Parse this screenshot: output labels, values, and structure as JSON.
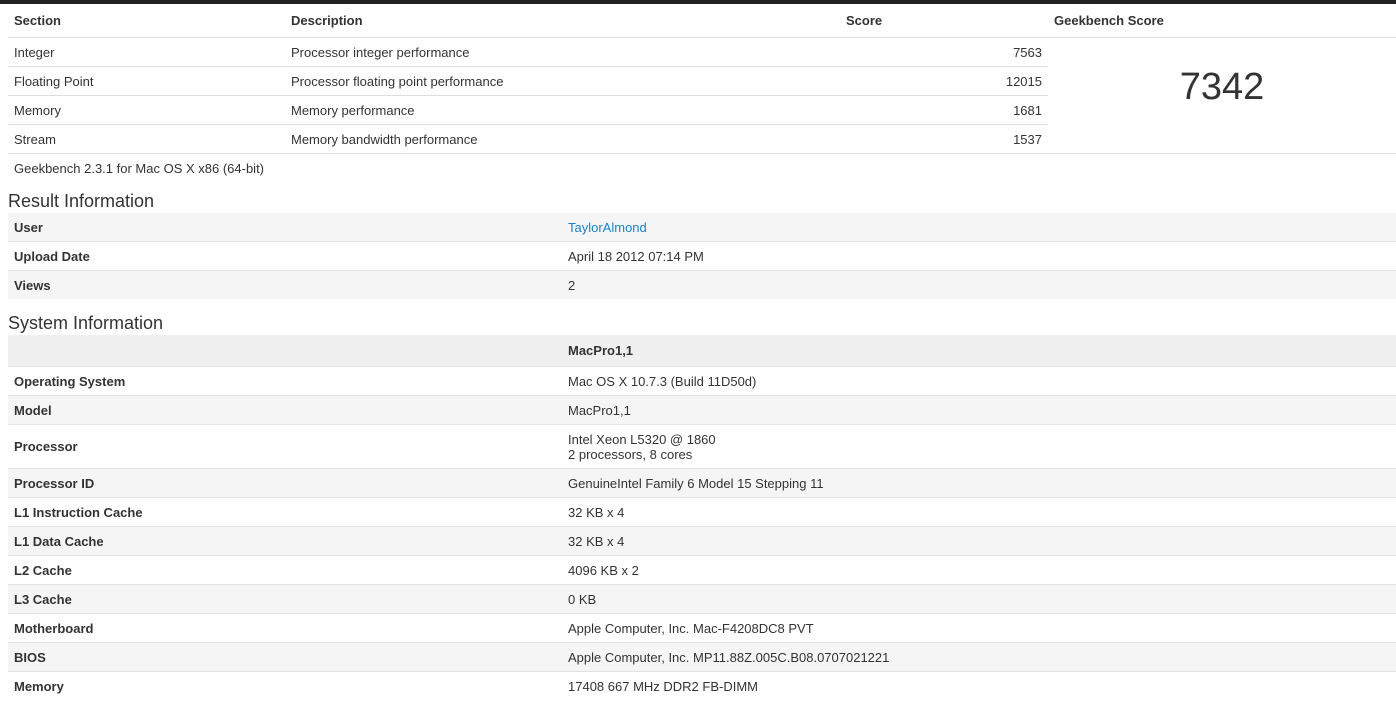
{
  "scores": {
    "headers": {
      "section": "Section",
      "description": "Description",
      "score": "Score",
      "geekbench": "Geekbench Score"
    },
    "rows": [
      {
        "section": "Integer",
        "description": "Processor integer performance",
        "score": "7563"
      },
      {
        "section": "Floating Point",
        "description": "Processor floating point performance",
        "score": "12015"
      },
      {
        "section": "Memory",
        "description": "Memory performance",
        "score": "1681"
      },
      {
        "section": "Stream",
        "description": "Memory bandwidth performance",
        "score": "1537"
      }
    ],
    "geekbench_score": "7342",
    "caption": "Geekbench 2.3.1 for Mac OS X x86 (64-bit)"
  },
  "result_info": {
    "title": "Result Information",
    "user": {
      "label": "User",
      "value": "TaylorAlmond"
    },
    "upload_date": {
      "label": "Upload Date",
      "value": "April 18 2012 07:14 PM"
    },
    "views": {
      "label": "Views",
      "value": "2"
    }
  },
  "system_info": {
    "title": "System Information",
    "header_value": "MacPro1,1",
    "rows": [
      {
        "label": "Operating System",
        "value": "Mac OS X 10.7.3 (Build 11D50d)"
      },
      {
        "label": "Model",
        "value": "MacPro1,1"
      },
      {
        "label": "Processor",
        "value": "Intel Xeon L5320 @ 1860",
        "value2": "2 processors, 8 cores"
      },
      {
        "label": "Processor ID",
        "value": "GenuineIntel Family 6 Model 15 Stepping 11"
      },
      {
        "label": "L1 Instruction Cache",
        "value": "32 KB x 4"
      },
      {
        "label": "L1 Data Cache",
        "value": "32 KB x 4"
      },
      {
        "label": "L2 Cache",
        "value": "4096 KB x 2"
      },
      {
        "label": "L3 Cache",
        "value": "0 KB"
      },
      {
        "label": "Motherboard",
        "value": "Apple Computer, Inc. Mac-F4208DC8 PVT"
      },
      {
        "label": "BIOS",
        "value": "Apple Computer, Inc. MP11.88Z.005C.B08.0707021221"
      },
      {
        "label": "Memory",
        "value": "17408 667 MHz DDR2 FB-DIMM"
      }
    ]
  }
}
